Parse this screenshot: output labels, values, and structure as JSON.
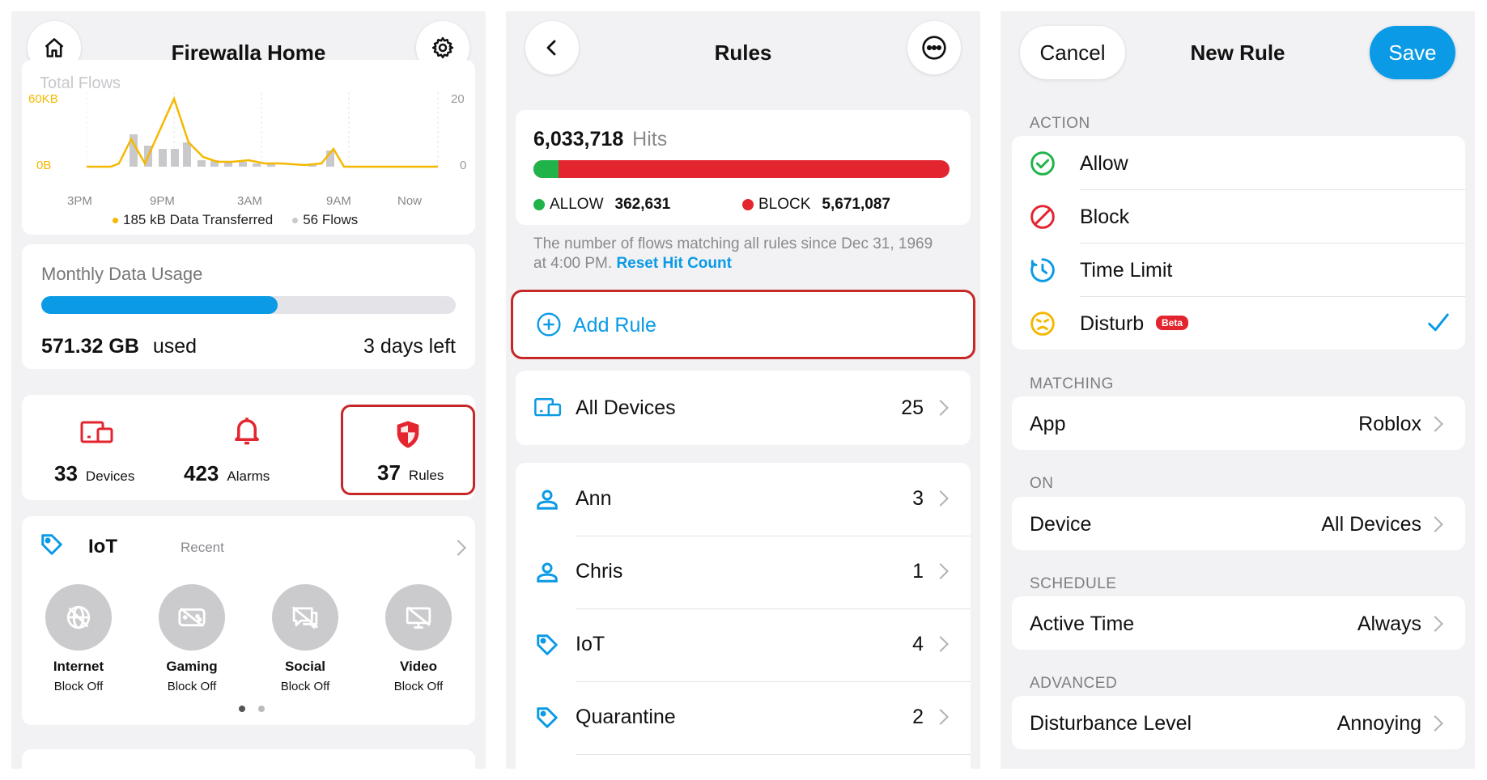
{
  "panel1": {
    "title": "Firewalla Home",
    "flows_card": {
      "label": "Total Flows",
      "y_left_top": "60KB",
      "y_left_bottom": "0B",
      "y_right_top": "20",
      "y_right_bottom": "0",
      "x_ticks": [
        "3PM",
        "9PM",
        "3AM",
        "9AM",
        "Now"
      ],
      "legend_data": "185 kB Data Transferred",
      "legend_flows": "56 Flows",
      "line_color": "#f5b800",
      "bar_color": "#c9c9cc"
    },
    "usage_card": {
      "label": "Monthly Data Usage",
      "amount": "571.32 GB",
      "used_label": "used",
      "days_left": "3 days left",
      "progress": 0.57,
      "bar_color": "#0a9ae6"
    },
    "stats": [
      {
        "value": "33",
        "label": "Devices"
      },
      {
        "value": "423",
        "label": "Alarms"
      },
      {
        "value": "37",
        "label": "Rules"
      }
    ],
    "iot_card": {
      "title": "IoT",
      "recent": "Recent",
      "items": [
        {
          "name": "Internet",
          "status": "Block Off"
        },
        {
          "name": "Gaming",
          "status": "Block Off"
        },
        {
          "name": "Social",
          "status": "Block Off"
        },
        {
          "name": "Video",
          "status": "Block Off"
        }
      ]
    }
  },
  "panel2": {
    "title": "Rules",
    "hits": "6,033,718",
    "hits_label": "Hits",
    "allow_label": "ALLOW",
    "allow_value": "362,631",
    "block_label": "BLOCK",
    "block_value": "5,671,087",
    "allow_fraction": 0.06,
    "allow_color": "#1fb34a",
    "block_color": "#e3252f",
    "note": "The number of flows matching all rules since Dec 31, 1969 at 4:00 PM.",
    "reset": "Reset Hit Count",
    "add_rule": "Add Rule",
    "all_devices": {
      "label": "All Devices",
      "count": "25"
    },
    "groups": [
      {
        "label": "Ann",
        "count": "3",
        "icon": "person-icon"
      },
      {
        "label": "Chris",
        "count": "1",
        "icon": "person-icon"
      },
      {
        "label": "IoT",
        "count": "4",
        "icon": "tag-icon"
      },
      {
        "label": "Quarantine",
        "count": "2",
        "icon": "tag-icon"
      }
    ]
  },
  "panel3": {
    "cancel": "Cancel",
    "title": "New Rule",
    "save": "Save",
    "action_header": "ACTION",
    "actions": [
      {
        "label": "Allow",
        "icon": "allow-check-icon",
        "color": "#1fb34a"
      },
      {
        "label": "Block",
        "icon": "block-icon",
        "color": "#e3252f"
      },
      {
        "label": "Time Limit",
        "icon": "time-limit-icon",
        "color": "#0a9ae6"
      },
      {
        "label": "Disturb",
        "icon": "disturb-face-icon",
        "color": "#f5b800",
        "badge": "Beta",
        "selected": true
      }
    ],
    "matching_header": "MATCHING",
    "app_label": "App",
    "app_value": "Roblox",
    "on_header": "ON",
    "device_label": "Device",
    "device_value": "All Devices",
    "schedule_header": "SCHEDULE",
    "active_label": "Active Time",
    "active_value": "Always",
    "advanced_header": "ADVANCED",
    "disturb_label": "Disturbance Level",
    "disturb_value": "Annoying"
  },
  "accent": "#0a9ae6",
  "highlight": "#c62828"
}
